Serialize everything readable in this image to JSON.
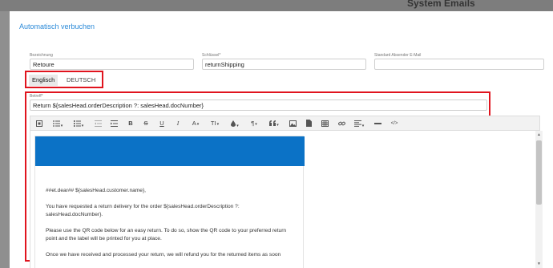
{
  "background": {
    "title": "System Emails"
  },
  "modal": {
    "title": "Automatisch verbuchen"
  },
  "fields": {
    "bezeichnung": {
      "label": "Bezeichnung",
      "value": "Retoure"
    },
    "schluessel": {
      "label": "Schlüssel*",
      "value": "returnShipping"
    },
    "absender": {
      "label": "Standard Absender E-Mail",
      "value": ""
    }
  },
  "tabs": [
    {
      "label": "Englisch",
      "active": true
    },
    {
      "label": "DEUTSCH",
      "active": false
    }
  ],
  "subject": {
    "label": "Betreff*",
    "value": "Return ${salesHead.orderDescription ?: salesHead.docNumber}"
  },
  "toolbar": {
    "bold": "B",
    "strike": "S",
    "underline": "U",
    "italic": "I",
    "font_color": "A",
    "font_size": "TI",
    "paragraph": "¶",
    "source": "</>"
  },
  "email": {
    "banner_color": "#0b72c6",
    "greeting": "##et.dear## ${salesHead.customer.name},",
    "para1": "You have requested a return delivery for the order ${salesHead.orderDescription ?: salesHead.docNumber}.",
    "para2": "Please use the QR code below for an easy return. To do so, show the QR code to your preferred return point and the label will be printed for you at place.",
    "para3": "Once we have received and processed your return, we will refund you for the returned items as soon"
  },
  "colors": {
    "highlight": "#e0141e",
    "accent": "#2b8ad8"
  }
}
